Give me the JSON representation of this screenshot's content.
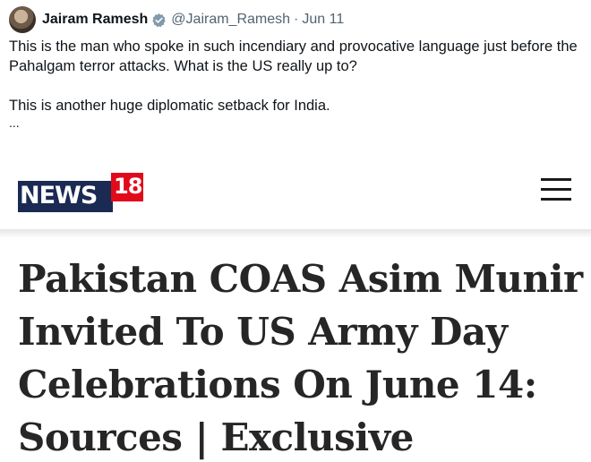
{
  "tweet": {
    "author_name": "Jairam Ramesh",
    "handle": "@Jairam_Ramesh",
    "separator": "·",
    "date": "Jun 11",
    "paragraphs": [
      "This is the man who spoke in such incendiary and provocative language just before the Pahalgam terror attacks. What is the US really up to?",
      "This is another huge diplomatic setback for India."
    ],
    "ellipsis": "...",
    "verified_color": "#829aab"
  },
  "news": {
    "logo_text": "NEWS",
    "logo_number": "18",
    "brand_colors": {
      "navy": "#1a2a53",
      "red": "#e10a1b"
    },
    "headline_lines": [
      "Pakistan COAS Asim Munir",
      "Invited To US Army Day",
      "Celebrations On June 14:",
      "Sources | Exclusive"
    ]
  }
}
